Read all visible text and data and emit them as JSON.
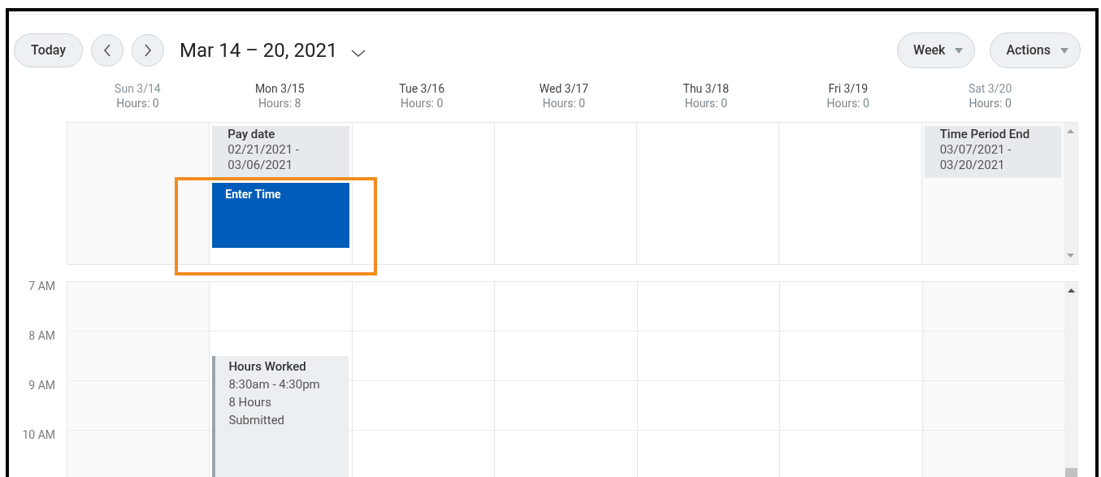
{
  "toolbar": {
    "today": "Today",
    "range": "Mar 14 – 20, 2021",
    "view_menu": "Week",
    "actions_menu": "Actions"
  },
  "days": [
    {
      "label": "Sun 3/14",
      "hours": "Hours: 0",
      "weekend": true
    },
    {
      "label": "Mon 3/15",
      "hours": "Hours: 8",
      "weekend": false,
      "all_day_events": [
        {
          "kind": "info",
          "title": "Pay date",
          "lines": [
            "02/21/2021 -",
            "03/06/2021"
          ]
        },
        {
          "kind": "action",
          "title": "Enter Time"
        }
      ],
      "timed_events": [
        {
          "title": "Hours Worked",
          "lines": [
            "8:30am - 4:30pm",
            "8 Hours",
            "Submitted"
          ]
        }
      ]
    },
    {
      "label": "Tue 3/16",
      "hours": "Hours: 0",
      "weekend": false
    },
    {
      "label": "Wed 3/17",
      "hours": "Hours: 0",
      "weekend": false
    },
    {
      "label": "Thu 3/18",
      "hours": "Hours: 0",
      "weekend": false
    },
    {
      "label": "Fri 3/19",
      "hours": "Hours: 0",
      "weekend": false
    },
    {
      "label": "Sat 3/20",
      "hours": "Hours: 0",
      "weekend": true,
      "all_day_events": [
        {
          "kind": "info",
          "title": "Time Period End",
          "lines": [
            "03/07/2021 -",
            "03/20/2021"
          ]
        }
      ]
    }
  ],
  "time_labels": [
    "7 AM",
    "8 AM",
    "9 AM",
    "10 AM"
  ]
}
